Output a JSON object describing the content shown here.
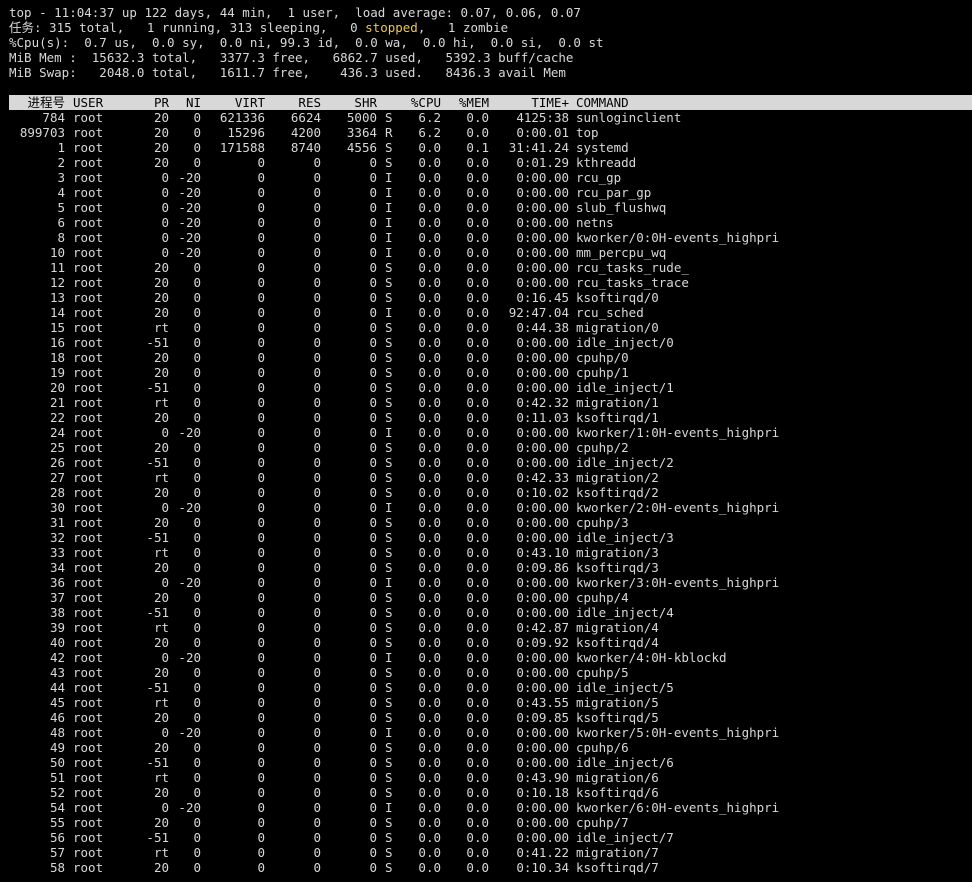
{
  "summary": {
    "line1": "top - 11:04:37 up 122 days, 44 min,  1 user,  load average: 0.07, 0.06, 0.07",
    "tasks_pre": "任务: 315 total,   1 running, 313 sleeping,   0 ",
    "tasks_stopped": "stopped",
    "tasks_post": ",   1 zombie",
    "cpu": "%Cpu(s):  0.7 us,  0.0 sy,  0.0 ni, 99.3 id,  0.0 wa,  0.0 hi,  0.0 si,  0.0 st",
    "mem": "MiB Mem :  15632.3 total,   3377.3 free,   6862.7 used,   5392.3 buff/cache",
    "swap": "MiB Swap:   2048.0 total,   1611.7 free,    436.3 used.   8436.3 avail Mem"
  },
  "columns": {
    "pid": "进程号",
    "user": "USER",
    "pr": "PR",
    "ni": "NI",
    "virt": "VIRT",
    "res": "RES",
    "shr": "SHR",
    "s": "",
    "cpu": "%CPU",
    "mem": "%MEM",
    "time": "TIME+",
    "cmd": "COMMAND"
  },
  "processes": [
    [
      "784",
      "root",
      "20",
      "0",
      "621336",
      "6624",
      "5000",
      "S",
      "6.2",
      "0.0",
      "4125:38",
      "sunloginclient"
    ],
    [
      "899703",
      "root",
      "20",
      "0",
      "15296",
      "4200",
      "3364",
      "R",
      "6.2",
      "0.0",
      "0:00.01",
      "top"
    ],
    [
      "1",
      "root",
      "20",
      "0",
      "171588",
      "8740",
      "4556",
      "S",
      "0.0",
      "0.1",
      "31:41.24",
      "systemd"
    ],
    [
      "2",
      "root",
      "20",
      "0",
      "0",
      "0",
      "0",
      "S",
      "0.0",
      "0.0",
      "0:01.29",
      "kthreadd"
    ],
    [
      "3",
      "root",
      "0",
      "-20",
      "0",
      "0",
      "0",
      "I",
      "0.0",
      "0.0",
      "0:00.00",
      "rcu_gp"
    ],
    [
      "4",
      "root",
      "0",
      "-20",
      "0",
      "0",
      "0",
      "I",
      "0.0",
      "0.0",
      "0:00.00",
      "rcu_par_gp"
    ],
    [
      "5",
      "root",
      "0",
      "-20",
      "0",
      "0",
      "0",
      "I",
      "0.0",
      "0.0",
      "0:00.00",
      "slub_flushwq"
    ],
    [
      "6",
      "root",
      "0",
      "-20",
      "0",
      "0",
      "0",
      "I",
      "0.0",
      "0.0",
      "0:00.00",
      "netns"
    ],
    [
      "8",
      "root",
      "0",
      "-20",
      "0",
      "0",
      "0",
      "I",
      "0.0",
      "0.0",
      "0:00.00",
      "kworker/0:0H-events_highpri"
    ],
    [
      "10",
      "root",
      "0",
      "-20",
      "0",
      "0",
      "0",
      "I",
      "0.0",
      "0.0",
      "0:00.00",
      "mm_percpu_wq"
    ],
    [
      "11",
      "root",
      "20",
      "0",
      "0",
      "0",
      "0",
      "S",
      "0.0",
      "0.0",
      "0:00.00",
      "rcu_tasks_rude_"
    ],
    [
      "12",
      "root",
      "20",
      "0",
      "0",
      "0",
      "0",
      "S",
      "0.0",
      "0.0",
      "0:00.00",
      "rcu_tasks_trace"
    ],
    [
      "13",
      "root",
      "20",
      "0",
      "0",
      "0",
      "0",
      "S",
      "0.0",
      "0.0",
      "0:16.45",
      "ksoftirqd/0"
    ],
    [
      "14",
      "root",
      "20",
      "0",
      "0",
      "0",
      "0",
      "I",
      "0.0",
      "0.0",
      "92:47.04",
      "rcu_sched"
    ],
    [
      "15",
      "root",
      "rt",
      "0",
      "0",
      "0",
      "0",
      "S",
      "0.0",
      "0.0",
      "0:44.38",
      "migration/0"
    ],
    [
      "16",
      "root",
      "-51",
      "0",
      "0",
      "0",
      "0",
      "S",
      "0.0",
      "0.0",
      "0:00.00",
      "idle_inject/0"
    ],
    [
      "18",
      "root",
      "20",
      "0",
      "0",
      "0",
      "0",
      "S",
      "0.0",
      "0.0",
      "0:00.00",
      "cpuhp/0"
    ],
    [
      "19",
      "root",
      "20",
      "0",
      "0",
      "0",
      "0",
      "S",
      "0.0",
      "0.0",
      "0:00.00",
      "cpuhp/1"
    ],
    [
      "20",
      "root",
      "-51",
      "0",
      "0",
      "0",
      "0",
      "S",
      "0.0",
      "0.0",
      "0:00.00",
      "idle_inject/1"
    ],
    [
      "21",
      "root",
      "rt",
      "0",
      "0",
      "0",
      "0",
      "S",
      "0.0",
      "0.0",
      "0:42.32",
      "migration/1"
    ],
    [
      "22",
      "root",
      "20",
      "0",
      "0",
      "0",
      "0",
      "S",
      "0.0",
      "0.0",
      "0:11.03",
      "ksoftirqd/1"
    ],
    [
      "24",
      "root",
      "0",
      "-20",
      "0",
      "0",
      "0",
      "I",
      "0.0",
      "0.0",
      "0:00.00",
      "kworker/1:0H-events_highpri"
    ],
    [
      "25",
      "root",
      "20",
      "0",
      "0",
      "0",
      "0",
      "S",
      "0.0",
      "0.0",
      "0:00.00",
      "cpuhp/2"
    ],
    [
      "26",
      "root",
      "-51",
      "0",
      "0",
      "0",
      "0",
      "S",
      "0.0",
      "0.0",
      "0:00.00",
      "idle_inject/2"
    ],
    [
      "27",
      "root",
      "rt",
      "0",
      "0",
      "0",
      "0",
      "S",
      "0.0",
      "0.0",
      "0:42.33",
      "migration/2"
    ],
    [
      "28",
      "root",
      "20",
      "0",
      "0",
      "0",
      "0",
      "S",
      "0.0",
      "0.0",
      "0:10.02",
      "ksoftirqd/2"
    ],
    [
      "30",
      "root",
      "0",
      "-20",
      "0",
      "0",
      "0",
      "I",
      "0.0",
      "0.0",
      "0:00.00",
      "kworker/2:0H-events_highpri"
    ],
    [
      "31",
      "root",
      "20",
      "0",
      "0",
      "0",
      "0",
      "S",
      "0.0",
      "0.0",
      "0:00.00",
      "cpuhp/3"
    ],
    [
      "32",
      "root",
      "-51",
      "0",
      "0",
      "0",
      "0",
      "S",
      "0.0",
      "0.0",
      "0:00.00",
      "idle_inject/3"
    ],
    [
      "33",
      "root",
      "rt",
      "0",
      "0",
      "0",
      "0",
      "S",
      "0.0",
      "0.0",
      "0:43.10",
      "migration/3"
    ],
    [
      "34",
      "root",
      "20",
      "0",
      "0",
      "0",
      "0",
      "S",
      "0.0",
      "0.0",
      "0:09.86",
      "ksoftirqd/3"
    ],
    [
      "36",
      "root",
      "0",
      "-20",
      "0",
      "0",
      "0",
      "I",
      "0.0",
      "0.0",
      "0:00.00",
      "kworker/3:0H-events_highpri"
    ],
    [
      "37",
      "root",
      "20",
      "0",
      "0",
      "0",
      "0",
      "S",
      "0.0",
      "0.0",
      "0:00.00",
      "cpuhp/4"
    ],
    [
      "38",
      "root",
      "-51",
      "0",
      "0",
      "0",
      "0",
      "S",
      "0.0",
      "0.0",
      "0:00.00",
      "idle_inject/4"
    ],
    [
      "39",
      "root",
      "rt",
      "0",
      "0",
      "0",
      "0",
      "S",
      "0.0",
      "0.0",
      "0:42.87",
      "migration/4"
    ],
    [
      "40",
      "root",
      "20",
      "0",
      "0",
      "0",
      "0",
      "S",
      "0.0",
      "0.0",
      "0:09.92",
      "ksoftirqd/4"
    ],
    [
      "42",
      "root",
      "0",
      "-20",
      "0",
      "0",
      "0",
      "I",
      "0.0",
      "0.0",
      "0:00.00",
      "kworker/4:0H-kblockd"
    ],
    [
      "43",
      "root",
      "20",
      "0",
      "0",
      "0",
      "0",
      "S",
      "0.0",
      "0.0",
      "0:00.00",
      "cpuhp/5"
    ],
    [
      "44",
      "root",
      "-51",
      "0",
      "0",
      "0",
      "0",
      "S",
      "0.0",
      "0.0",
      "0:00.00",
      "idle_inject/5"
    ],
    [
      "45",
      "root",
      "rt",
      "0",
      "0",
      "0",
      "0",
      "S",
      "0.0",
      "0.0",
      "0:43.55",
      "migration/5"
    ],
    [
      "46",
      "root",
      "20",
      "0",
      "0",
      "0",
      "0",
      "S",
      "0.0",
      "0.0",
      "0:09.85",
      "ksoftirqd/5"
    ],
    [
      "48",
      "root",
      "0",
      "-20",
      "0",
      "0",
      "0",
      "I",
      "0.0",
      "0.0",
      "0:00.00",
      "kworker/5:0H-events_highpri"
    ],
    [
      "49",
      "root",
      "20",
      "0",
      "0",
      "0",
      "0",
      "S",
      "0.0",
      "0.0",
      "0:00.00",
      "cpuhp/6"
    ],
    [
      "50",
      "root",
      "-51",
      "0",
      "0",
      "0",
      "0",
      "S",
      "0.0",
      "0.0",
      "0:00.00",
      "idle_inject/6"
    ],
    [
      "51",
      "root",
      "rt",
      "0",
      "0",
      "0",
      "0",
      "S",
      "0.0",
      "0.0",
      "0:43.90",
      "migration/6"
    ],
    [
      "52",
      "root",
      "20",
      "0",
      "0",
      "0",
      "0",
      "S",
      "0.0",
      "0.0",
      "0:10.18",
      "ksoftirqd/6"
    ],
    [
      "54",
      "root",
      "0",
      "-20",
      "0",
      "0",
      "0",
      "I",
      "0.0",
      "0.0",
      "0:00.00",
      "kworker/6:0H-events_highpri"
    ],
    [
      "55",
      "root",
      "20",
      "0",
      "0",
      "0",
      "0",
      "S",
      "0.0",
      "0.0",
      "0:00.00",
      "cpuhp/7"
    ],
    [
      "56",
      "root",
      "-51",
      "0",
      "0",
      "0",
      "0",
      "S",
      "0.0",
      "0.0",
      "0:00.00",
      "idle_inject/7"
    ],
    [
      "57",
      "root",
      "rt",
      "0",
      "0",
      "0",
      "0",
      "S",
      "0.0",
      "0.0",
      "0:41.22",
      "migration/7"
    ],
    [
      "58",
      "root",
      "20",
      "0",
      "0",
      "0",
      "0",
      "S",
      "0.0",
      "0.0",
      "0:10.34",
      "ksoftirqd/7"
    ]
  ]
}
